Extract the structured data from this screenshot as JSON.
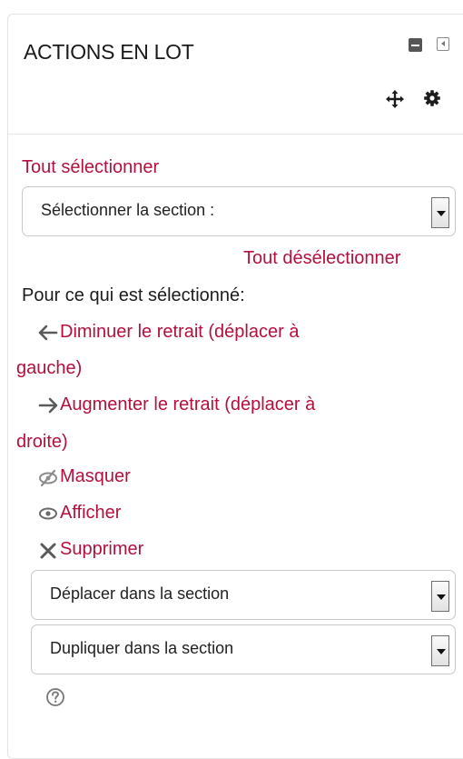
{
  "block": {
    "title": "ACTIONS EN LOT",
    "icons": {
      "collapse": "minus-square-icon",
      "dock": "dock-left-icon",
      "move": "move-arrows-icon",
      "settings": "gear-icon"
    }
  },
  "select_all_label": "Tout sélectionner",
  "section_select": {
    "value": "Sélectionner la section :"
  },
  "deselect_all_label": "Tout désélectionner",
  "for_selected_label": "Pour ce qui est sélectionné:",
  "actions": {
    "decrease_indent": {
      "line1": "Diminuer le retrait (déplacer à",
      "line2": "gauche)",
      "icon": "arrow-left-icon"
    },
    "increase_indent": {
      "line1": "Augmenter le retrait (déplacer à",
      "line2": "droite)",
      "icon": "arrow-right-icon"
    },
    "hide": {
      "label": "Masquer",
      "icon": "eye-slash-icon"
    },
    "show": {
      "label": "Afficher",
      "icon": "eye-icon"
    },
    "delete": {
      "label": "Supprimer",
      "icon": "times-icon"
    }
  },
  "move_select": {
    "value": "Déplacer dans la section"
  },
  "duplicate_select": {
    "value": "Dupliquer dans la section"
  },
  "help_icon": "question-circle-icon",
  "colors": {
    "link": "#b3103e",
    "text": "#1c1c1c",
    "icon": "#5a5a5a"
  }
}
